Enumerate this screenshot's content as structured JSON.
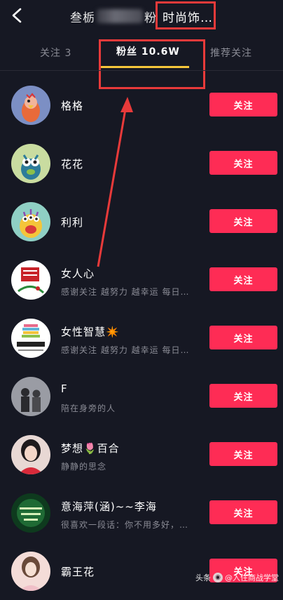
{
  "header": {
    "title_visible": "叁栃",
    "title_mid": "粉",
    "title_tail": "时尚饰…"
  },
  "tabs": [
    {
      "label": "关注 3"
    },
    {
      "label": "粉丝 10.6W"
    },
    {
      "label": "推荐关注"
    }
  ],
  "followers": [
    {
      "name": "格格",
      "sub": "",
      "button": "关注",
      "avatar": "chicken-cartoon-icon"
    },
    {
      "name": "花花",
      "sub": "",
      "button": "关注",
      "avatar": "green-monster-icon"
    },
    {
      "name": "利利",
      "sub": "",
      "button": "关注",
      "avatar": "yellow-monster-icon"
    },
    {
      "name": "女人心",
      "sub": "感谢关注 越努力 越幸运 每日…",
      "button": "关注",
      "avatar": "red-logo-icon"
    },
    {
      "name": "女性智慧✴️",
      "sub": "感谢关注 越努力 越幸运 每日…",
      "button": "关注",
      "avatar": "books-logo-icon"
    },
    {
      "name": "F",
      "sub": "陪在身旁的人",
      "button": "关注",
      "avatar": "couple-photo-icon"
    },
    {
      "name": "梦想🌷百合",
      "sub": "静静的思念",
      "button": "关注",
      "avatar": "woman-photo-icon"
    },
    {
      "name": "意海萍(涵)~~李海",
      "sub": "很喜欢一段话：你不用多好，…",
      "button": "关注",
      "avatar": "green-text-icon"
    },
    {
      "name": "霸王花",
      "sub": "",
      "button": "关注",
      "avatar": "woman-portrait-icon"
    }
  ],
  "watermark": {
    "prefix": "头条",
    "text": "@入住商战学堂"
  },
  "colors": {
    "background": "#161823",
    "button": "#fe2c55",
    "tab_underline": "#f6c73b",
    "annotation": "#e83a3a"
  }
}
